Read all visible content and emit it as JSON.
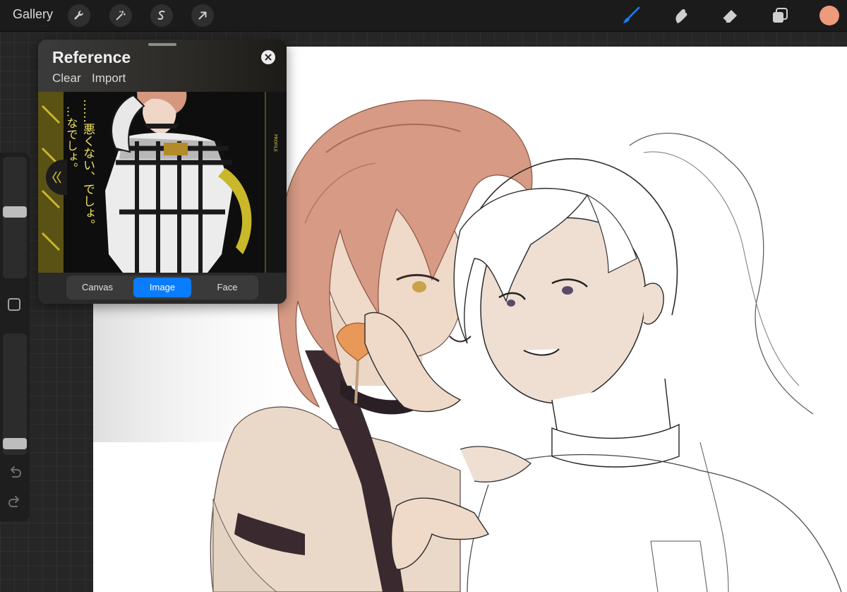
{
  "app": {
    "gallery_label": "Gallery",
    "left_tools": [
      "wrench-icon",
      "magic-wand-icon",
      "selection-icon",
      "transform-arrow-icon"
    ],
    "right_tools": [
      "brush-icon",
      "smudge-icon",
      "eraser-icon",
      "layers-icon"
    ],
    "active_tool": "brush-icon",
    "accent_color": "#1a7cff",
    "current_color": "#ee9b7c"
  },
  "reference": {
    "title": "Reference",
    "clear_label": "Clear",
    "import_label": "Import",
    "tabs": [
      {
        "label": "Canvas"
      },
      {
        "label": "Image"
      },
      {
        "label": "Face"
      }
    ],
    "active_tab": "Image",
    "image_text": {
      "vertical_jp_1": "…なでしょ。",
      "vertical_jp_2": "……悪くない、でしょ。",
      "side_label": "PROFILE"
    }
  },
  "sidebar": {
    "brush_size_level": 0.55,
    "brush_opacity_level": 0.05
  }
}
